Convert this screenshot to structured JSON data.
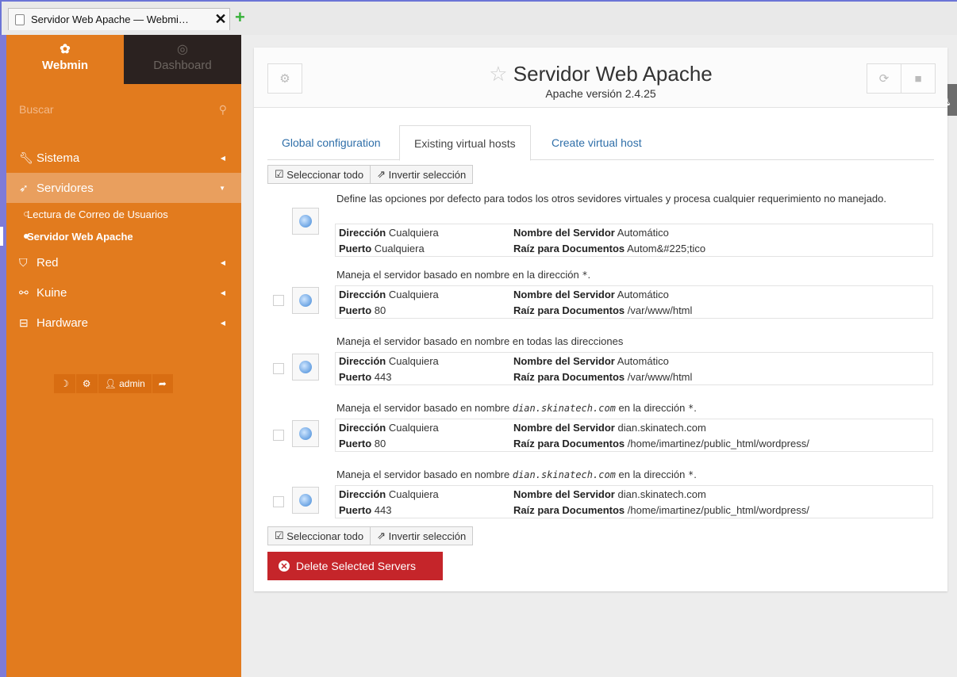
{
  "browser": {
    "tab_title": "Servidor Web Apache — Webmi…",
    "close_glyph": "✕",
    "newtab_glyph": "+"
  },
  "sidebar": {
    "webmin_label": "Webmin",
    "dashboard_label": "Dashboard",
    "search_placeholder": "Buscar",
    "items": [
      {
        "label": "Sistema",
        "icon": "wrench-icon"
      },
      {
        "label": "Servidores",
        "icon": "rocket-icon"
      },
      {
        "label": "Red",
        "icon": "shield-icon"
      },
      {
        "label": "Kuine",
        "icon": "link-icon"
      },
      {
        "label": "Hardware",
        "icon": "hdd-icon"
      }
    ],
    "subitems": [
      {
        "label": "Lectura de Correo de Usuarios"
      },
      {
        "label": "Servidor Web Apache"
      }
    ],
    "user": "admin"
  },
  "header": {
    "title": "Servidor Web Apache",
    "subtitle": "Apache versión 2.4.25"
  },
  "tabs": [
    "Global configuration",
    "Existing virtual hosts",
    "Create virtual host"
  ],
  "selbar": {
    "select_all": "Seleccionar todo",
    "invert": "Invertir selección"
  },
  "labels": {
    "address": "Dirección",
    "port": "Puerto",
    "server_name": "Nombre del Servidor",
    "doc_root": "Raíz para Documentos"
  },
  "vhosts": [
    {
      "desc": "Define las opciones por defecto para todos los otros sevidores virtuales y procesa cualquier requerimiento no manejado.",
      "address": "Cualquiera",
      "port": "Cualquiera",
      "server_name": "Automático",
      "doc_root": "Autom&#225;tico"
    },
    {
      "desc_pre": "Maneja el servidor basado en nombre ",
      "desc_host": "",
      "desc_post": " en la dirección ",
      "desc_star": "*",
      "desc_end": ".",
      "address": "Cualquiera",
      "port": "80",
      "server_name": "Automático",
      "doc_root": "/var/www/html"
    },
    {
      "desc_pre": "Maneja el servidor basado en nombre ",
      "desc_post": " en todas las direcciones",
      "address": "Cualquiera",
      "port": "443",
      "server_name": "Automático",
      "doc_root": "/var/www/html"
    },
    {
      "desc_pre": "Maneja el servidor basado en nombre ",
      "desc_host": "dian.skinatech.com",
      "desc_post": " en la dirección ",
      "desc_star": "*",
      "desc_end": ".",
      "address": "Cualquiera",
      "port": "80",
      "server_name": "dian.skinatech.com",
      "doc_root": "/home/imartinez/public_html/wordpress/"
    },
    {
      "desc_pre": "Maneja el servidor basado en nombre ",
      "desc_host": "dian.skinatech.com",
      "desc_post": " en la dirección ",
      "desc_star": "*",
      "desc_end": ".",
      "address": "Cualquiera",
      "port": "443",
      "server_name": "dian.skinatech.com",
      "doc_root": "/home/imartinez/public_html/wordpress/"
    }
  ],
  "delete_label": "Delete Selected Servers",
  "colors": {
    "sidebar": "#e27b1e",
    "delete": "#c5252a",
    "link": "#2f6fa9"
  }
}
